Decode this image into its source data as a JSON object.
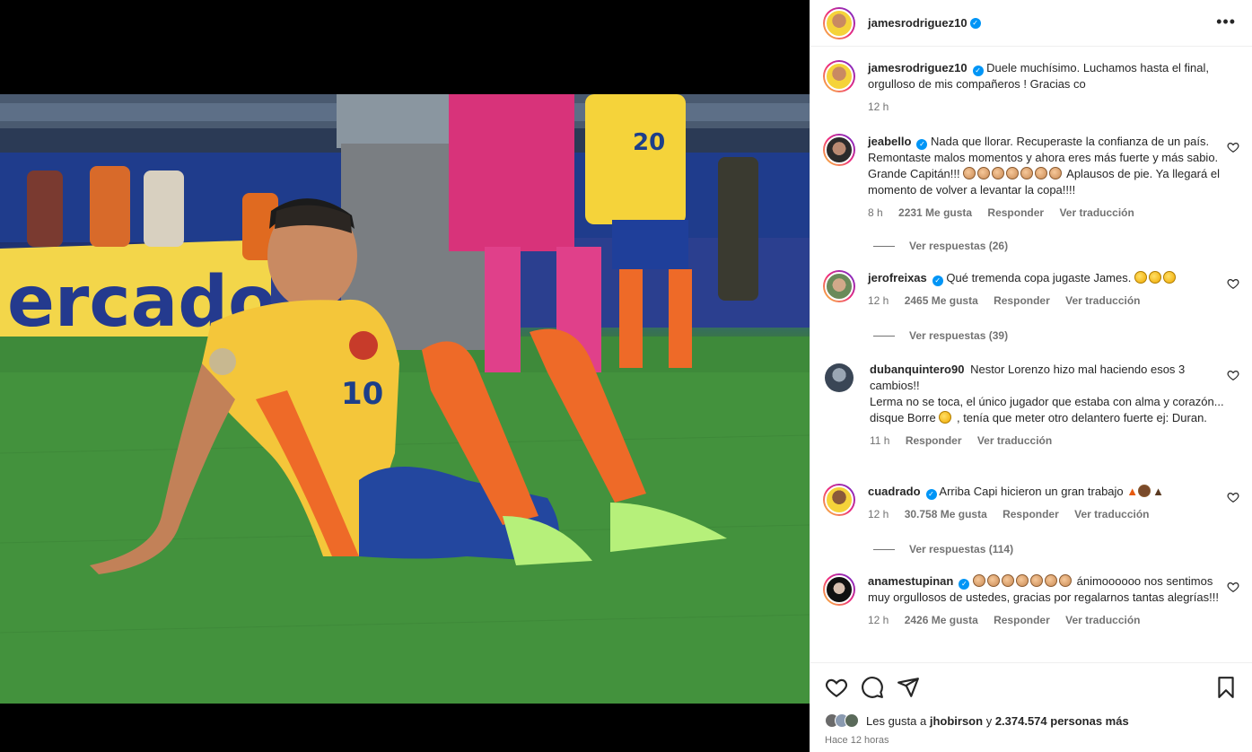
{
  "header": {
    "username": "jamesrodriguez10",
    "more_label": "•••"
  },
  "caption": {
    "username": "jamesrodriguez10",
    "text": "Duele muchísimo. Luchamos hasta el final, orgulloso de mis compañeros ! Gracias co",
    "time": "12 h"
  },
  "comments": [
    {
      "username": "jeabello",
      "verified": true,
      "text_a": "Nada que llorar. Recuperaste la confianza de un país. Remontaste malos momentos y ahora eres más fuerte y más sabio. Grande Capitán!!!",
      "text_b": "Aplausos de pie. Ya llegará el momento de volver a levantar la copa!!!!",
      "time": "8 h",
      "likes": "2231 Me gusta",
      "reply": "Responder",
      "translate": "Ver traducción",
      "replies": "Ver respuestas (26)"
    },
    {
      "username": "jerofreixas",
      "verified": true,
      "text_a": "Qué tremenda copa jugaste James.",
      "time": "12 h",
      "likes": "2465 Me gusta",
      "reply": "Responder",
      "translate": "Ver traducción",
      "replies": "Ver respuestas (39)"
    },
    {
      "username": "dubanquintero90",
      "verified": false,
      "text_a": "Nestor Lorenzo hizo mal haciendo esos 3 cambios!!",
      "text_b": "Lerma no se toca, el único jugador que estaba con alma y corazón... disque Borre",
      "text_c": ", tenía que meter otro delantero fuerte ej: Duran.",
      "time": "11 h",
      "reply": "Responder",
      "translate": "Ver traducción"
    },
    {
      "username": "cuadrado",
      "verified": true,
      "text_a": "Arriba Capi hicieron un gran trabajo",
      "time": "12 h",
      "likes": "30.758 Me gusta",
      "reply": "Responder",
      "translate": "Ver traducción",
      "replies": "Ver respuestas (114)"
    },
    {
      "username": "anamestupinan",
      "verified": true,
      "text_a": "ánimoooooo nos sentimos muy orgullosos de ustedes, gracias por regalarnos tantas alegrías!!!",
      "time": "12 h",
      "likes": "2426 Me gusta",
      "reply": "Responder",
      "translate": "Ver traducción"
    }
  ],
  "footer": {
    "likes_prefix": "Les gusta a",
    "liked_by": "jhobirson",
    "likes_connector": "y",
    "likes_count": "2.374.574 personas más",
    "time_ago": "Hace 12 horas"
  },
  "photo": {
    "banner_text": "ercado libre",
    "jersey_number": "10",
    "jersey_number_back": "20"
  },
  "colors": {
    "accent": "#0095f6",
    "text": "#262626",
    "muted": "#737373"
  }
}
